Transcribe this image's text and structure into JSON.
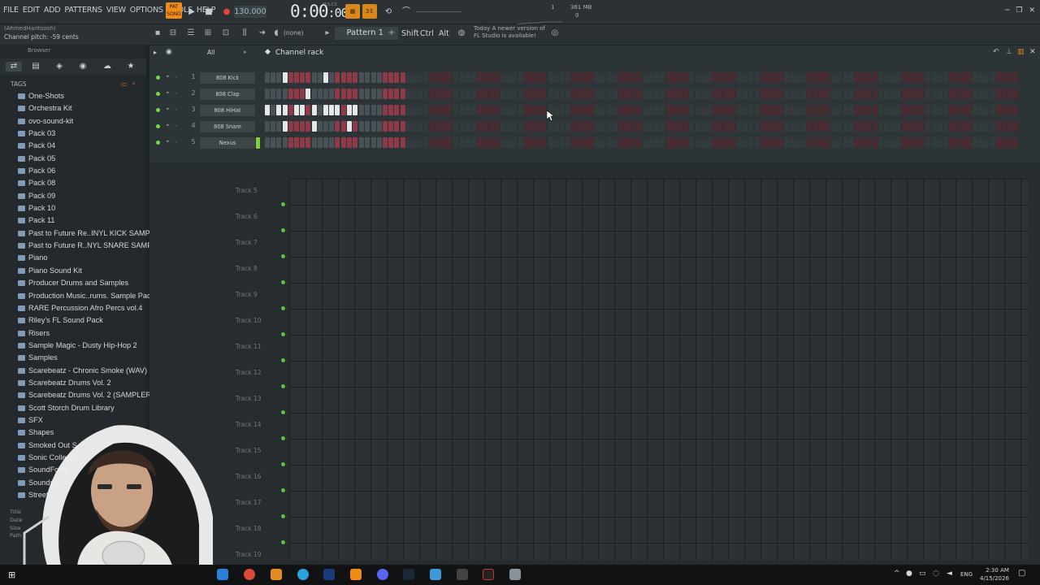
{
  "menu": [
    "FILE",
    "EDIT",
    "ADD",
    "PATTERNS",
    "VIEW",
    "OPTIONS",
    "TOOLS",
    "HELP"
  ],
  "pat_badge": "PAT\nSONG",
  "tempo": "130.000",
  "time_display": "0:00",
  "time_sub": ":00",
  "time_label": "M:S:CS",
  "memory": "361 MB",
  "memory_sub": "0",
  "counter": "1",
  "hint_user": "(AhmedHantoosh)",
  "hint_text": "Channel pitch: -59 cents",
  "pattern_name": "Pattern 1",
  "snap": "(none)",
  "mod_keys": [
    "Shift",
    "Ctrl",
    "Alt"
  ],
  "news_line1": "Today  A newer version of",
  "news_line2": "FL Studio is available!",
  "browser_title": "Browser",
  "tags_label": "TAGS",
  "browser_items": [
    "One-Shots",
    "Orchestra Kit",
    "ovo-sound-kit",
    "Pack 03",
    "Pack 04",
    "Pack 05",
    "Pack 06",
    "Pack 08",
    "Pack 09",
    "Pack 10",
    "Pack 11",
    "Past to Future Re..INYL KICK SAMPLES",
    "Past to Future R..NYL SNARE SAMPLES",
    "Piano",
    "Piano Sound Kit",
    "Producer Drums and Samples",
    "Production Music..rums. Sample Pack",
    "RARE Percussion Afro Percs vol.4",
    "Riley's FL Sound Pack",
    "Risers",
    "Sample Magic - Dusty Hip-Hop 2",
    "Samples",
    "Scarebeatz - Chronic Smoke (WAV)",
    "Scarebeatz Drums Vol. 2",
    "Scarebeatz Drums Vol. 2 (SAMPLER)",
    "Scott Storch Drum Library",
    "SFX",
    "Shapes",
    "Smoked Out S",
    "Sonic Collectiv",
    "SoundFonts",
    "Sounds",
    "Street"
  ],
  "info_labels": [
    "Title",
    "Date",
    "Size",
    "Path"
  ],
  "rack_filter": "All",
  "rack_title": "Channel rack",
  "channels": [
    {
      "num": "1",
      "name": "808 Kick",
      "lit": [
        3,
        10
      ]
    },
    {
      "num": "2",
      "name": "808 Clap",
      "lit": [
        7
      ]
    },
    {
      "num": "3",
      "name": "808 HiHat",
      "lit": [
        0,
        2,
        3,
        5,
        6,
        8,
        10,
        11,
        12,
        14,
        15
      ]
    },
    {
      "num": "4",
      "name": "808 Snare",
      "lit": [
        3,
        8,
        14
      ]
    },
    {
      "num": "5",
      "name": "Nexus",
      "lit": []
    }
  ],
  "tracks": [
    "Track 5",
    "Track 6",
    "Track 7",
    "Track 8",
    "Track 9",
    "Track 10",
    "Track 11",
    "Track 12",
    "Track 13",
    "Track 14",
    "Track 15",
    "Track 16",
    "Track 17",
    "Track 18",
    "Track 19"
  ],
  "tray_lang": "ENG",
  "clock_time": "2:30 AM",
  "clock_date": "4/15/2026"
}
